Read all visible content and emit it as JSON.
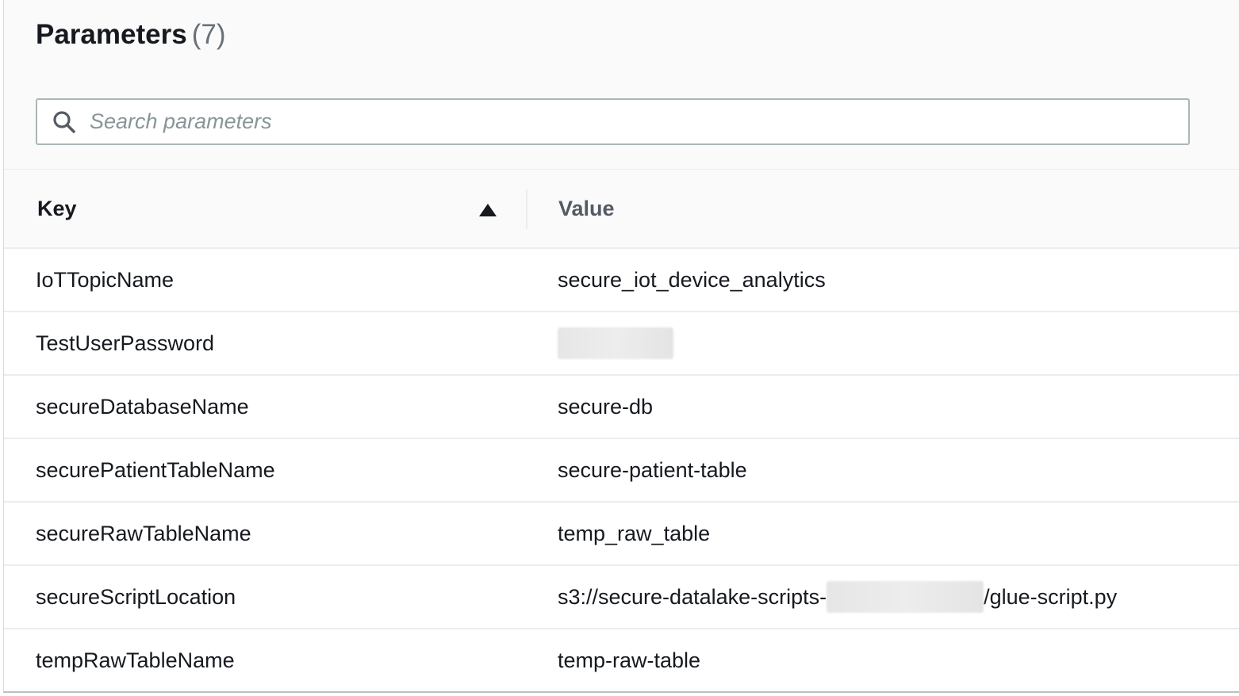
{
  "header": {
    "title": "Parameters",
    "count": "(7)"
  },
  "search": {
    "placeholder": "Search parameters"
  },
  "table": {
    "columns": {
      "key": "Key",
      "value": "Value"
    },
    "sort": {
      "column": "Key",
      "direction": "ascending"
    },
    "rows": [
      {
        "key": "IoTTopicName",
        "value": "secure_iot_device_analytics"
      },
      {
        "key": "TestUserPassword",
        "value": ""
      },
      {
        "key": "secureDatabaseName",
        "value": "secure-db"
      },
      {
        "key": "securePatientTableName",
        "value": "secure-patient-table"
      },
      {
        "key": "secureRawTableName",
        "value": "temp_raw_table"
      },
      {
        "key": "secureScriptLocation",
        "value_prefix": "s3://secure-datalake-scripts-",
        "value_suffix": "/glue-script.py"
      },
      {
        "key": "tempRawTableName",
        "value": "temp-raw-table"
      }
    ]
  },
  "icons": {
    "search": "search-icon",
    "sort": "sort-ascending-icon"
  },
  "colors": {
    "title_text": "#16191f",
    "count_text": "#687078",
    "placeholder_text": "#879596",
    "value_header_text": "#545b64",
    "header_background": "#fafafa",
    "row_divider": "#eaeded",
    "input_border": "#aab7b8"
  }
}
